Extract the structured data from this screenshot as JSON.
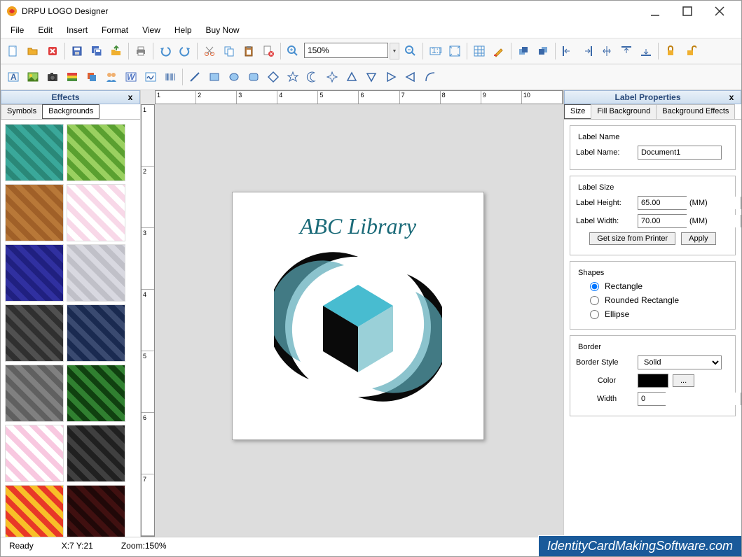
{
  "app": {
    "title": "DRPU LOGO Designer"
  },
  "menu": [
    "File",
    "Edit",
    "Insert",
    "Format",
    "View",
    "Help",
    "Buy Now"
  ],
  "zoom": "150%",
  "effects": {
    "title": "Effects",
    "tabs": [
      "Symbols",
      "Backgrounds"
    ],
    "active_tab": "Backgrounds"
  },
  "canvas": {
    "text": "ABC Library"
  },
  "ruler_h": [
    "1",
    "2",
    "3",
    "4",
    "5",
    "6",
    "7",
    "8",
    "9",
    "10"
  ],
  "ruler_v": [
    "1",
    "2",
    "3",
    "4",
    "5",
    "6",
    "7"
  ],
  "properties": {
    "title": "Label Properties",
    "tabs": [
      "Size",
      "Fill Background",
      "Background Effects"
    ],
    "active_tab": "Size",
    "label_name_section": "Label Name",
    "label_name_label": "Label Name:",
    "label_name_value": "Document1",
    "label_size_section": "Label Size",
    "label_height_label": "Label Height:",
    "label_height_value": "65.00",
    "label_width_label": "Label Width:",
    "label_width_value": "70.00",
    "unit": "(MM)",
    "get_size_btn": "Get size from Printer",
    "apply_btn": "Apply",
    "shapes_section": "Shapes",
    "shapes": [
      "Rectangle",
      "Rounded Rectangle",
      "Ellipse"
    ],
    "shape_selected": "Rectangle",
    "border_section": "Border",
    "border_style_label": "Border Style",
    "border_style_value": "Solid",
    "color_label": "Color",
    "color_value": "#000000",
    "color_btn": "...",
    "width_label": "Width",
    "width_value": "0"
  },
  "status": {
    "ready": "Ready",
    "coords": "X:7  Y:21",
    "zoom": "Zoom:150%"
  },
  "watermark": "IdentityCardMakingSoftware.com",
  "thumbs": [
    {
      "c1": "#3aa89a",
      "c2": "#2a8878"
    },
    {
      "c1": "#5aa030",
      "c2": "#9ad060"
    },
    {
      "c1": "#b87838",
      "c2": "#a06028"
    },
    {
      "c1": "#f8d8e8",
      "c2": "#ffffff"
    },
    {
      "c1": "#3030a0",
      "c2": "#202080"
    },
    {
      "c1": "#d8d8e0",
      "c2": "#c0c0c8"
    },
    {
      "c1": "#505050",
      "c2": "#303030"
    },
    {
      "c1": "#1a2a50",
      "c2": "#3a4a70"
    },
    {
      "c1": "#808080",
      "c2": "#606060"
    },
    {
      "c1": "#104010",
      "c2": "#308030"
    },
    {
      "c1": "#f8c8e0",
      "c2": "#ffffff"
    },
    {
      "c1": "#202020",
      "c2": "#404040"
    },
    {
      "c1": "#f8c028",
      "c2": "#e83828"
    },
    {
      "c1": "#401010",
      "c2": "#200808"
    }
  ]
}
